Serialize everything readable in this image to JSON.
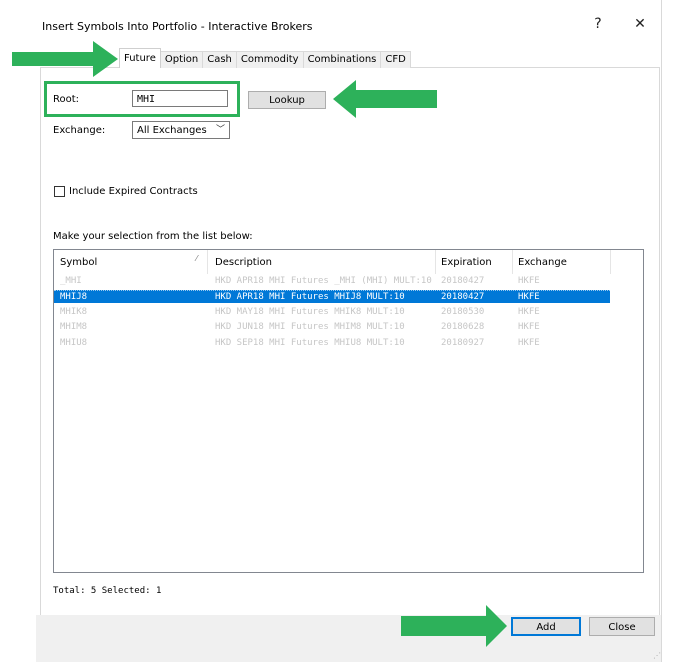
{
  "window": {
    "title": "Insert Symbols Into Portfolio - Interactive Brokers",
    "help_glyph": "?",
    "close_glyph": "✕"
  },
  "tabs": [
    "Future",
    "Option",
    "Cash",
    "Commodity",
    "Combinations",
    "CFD"
  ],
  "active_tab": "Future",
  "form": {
    "root_label": "Root:",
    "root_value": "MHI",
    "lookup_label": "Lookup",
    "exchange_label": "Exchange:",
    "exchange_value": "All Exchanges",
    "include_expired_label": "Include Expired Contracts",
    "include_expired_checked": false
  },
  "list": {
    "prompt": "Make your selection from the list below:",
    "columns": [
      "Symbol",
      "Description",
      "Expiration",
      "Exchange"
    ],
    "rows": [
      {
        "symbol": "_MHI",
        "description": "HKD APR18 MHI Futures _MHI (MHI) MULT:10",
        "expiration": "20180427",
        "exchange": "HKFE"
      },
      {
        "symbol": "MHIJ8",
        "description": "HKD APR18 MHI Futures MHIJ8 MULT:10",
        "expiration": "20180427",
        "exchange": "HKFE"
      },
      {
        "symbol": "MHIK8",
        "description": "HKD MAY18 MHI Futures MHIK8 MULT:10",
        "expiration": "20180530",
        "exchange": "HKFE"
      },
      {
        "symbol": "MHIM8",
        "description": "HKD JUN18 MHI Futures MHIM8 MULT:10",
        "expiration": "20180628",
        "exchange": "HKFE"
      },
      {
        "symbol": "MHIU8",
        "description": "HKD SEP18 MHI Futures MHIU8 MULT:10",
        "expiration": "20180927",
        "exchange": "HKFE"
      }
    ],
    "selected_index": 1
  },
  "totals_text": "Total: 5  Selected: 1",
  "buttons": {
    "add": "Add",
    "close": "Close"
  },
  "colors": {
    "selection": "#0078d7",
    "annotation_green": "#2db15a"
  }
}
